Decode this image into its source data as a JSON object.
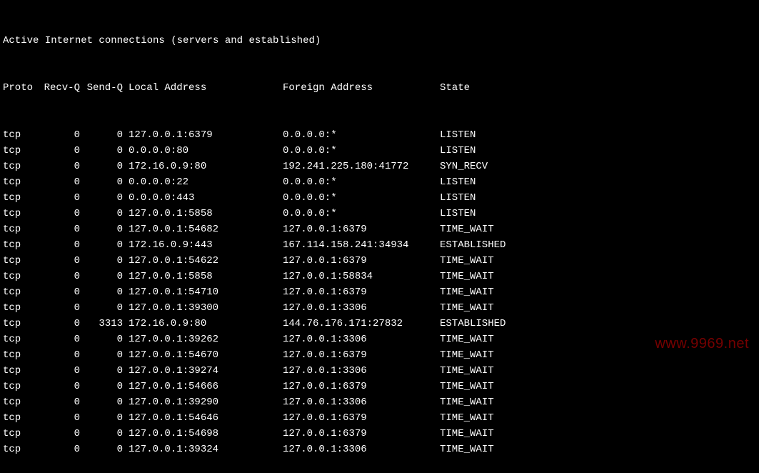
{
  "title": "Active Internet connections (servers and established)",
  "headers": {
    "proto": "Proto",
    "recvq": "Recv-Q",
    "sendq": "Send-Q",
    "local": "Local Address",
    "foreign": "Foreign Address",
    "state": "State"
  },
  "rows": [
    {
      "proto": "tcp",
      "recvq": "0",
      "sendq": "0",
      "local": "127.0.0.1:6379",
      "foreign": "0.0.0.0:*",
      "state": "LISTEN"
    },
    {
      "proto": "tcp",
      "recvq": "0",
      "sendq": "0",
      "local": "0.0.0.0:80",
      "foreign": "0.0.0.0:*",
      "state": "LISTEN"
    },
    {
      "proto": "tcp",
      "recvq": "0",
      "sendq": "0",
      "local": "172.16.0.9:80",
      "foreign": "192.241.225.180:41772",
      "state": "SYN_RECV"
    },
    {
      "proto": "tcp",
      "recvq": "0",
      "sendq": "0",
      "local": "0.0.0.0:22",
      "foreign": "0.0.0.0:*",
      "state": "LISTEN"
    },
    {
      "proto": "tcp",
      "recvq": "0",
      "sendq": "0",
      "local": "0.0.0.0:443",
      "foreign": "0.0.0.0:*",
      "state": "LISTEN"
    },
    {
      "proto": "tcp",
      "recvq": "0",
      "sendq": "0",
      "local": "127.0.0.1:5858",
      "foreign": "0.0.0.0:*",
      "state": "LISTEN"
    },
    {
      "proto": "tcp",
      "recvq": "0",
      "sendq": "0",
      "local": "127.0.0.1:54682",
      "foreign": "127.0.0.1:6379",
      "state": "TIME_WAIT"
    },
    {
      "proto": "tcp",
      "recvq": "0",
      "sendq": "0",
      "local": "172.16.0.9:443",
      "foreign": "167.114.158.241:34934",
      "state": "ESTABLISHED"
    },
    {
      "proto": "tcp",
      "recvq": "0",
      "sendq": "0",
      "local": "127.0.0.1:54622",
      "foreign": "127.0.0.1:6379",
      "state": "TIME_WAIT"
    },
    {
      "proto": "tcp",
      "recvq": "0",
      "sendq": "0",
      "local": "127.0.0.1:5858",
      "foreign": "127.0.0.1:58834",
      "state": "TIME_WAIT"
    },
    {
      "proto": "tcp",
      "recvq": "0",
      "sendq": "0",
      "local": "127.0.0.1:54710",
      "foreign": "127.0.0.1:6379",
      "state": "TIME_WAIT"
    },
    {
      "proto": "tcp",
      "recvq": "0",
      "sendq": "0",
      "local": "127.0.0.1:39300",
      "foreign": "127.0.0.1:3306",
      "state": "TIME_WAIT"
    },
    {
      "proto": "tcp",
      "recvq": "0",
      "sendq": "3313",
      "local": "172.16.0.9:80",
      "foreign": "144.76.176.171:27832",
      "state": "ESTABLISHED"
    },
    {
      "proto": "tcp",
      "recvq": "0",
      "sendq": "0",
      "local": "127.0.0.1:39262",
      "foreign": "127.0.0.1:3306",
      "state": "TIME_WAIT"
    },
    {
      "proto": "tcp",
      "recvq": "0",
      "sendq": "0",
      "local": "127.0.0.1:54670",
      "foreign": "127.0.0.1:6379",
      "state": "TIME_WAIT"
    },
    {
      "proto": "tcp",
      "recvq": "0",
      "sendq": "0",
      "local": "127.0.0.1:39274",
      "foreign": "127.0.0.1:3306",
      "state": "TIME_WAIT"
    },
    {
      "proto": "tcp",
      "recvq": "0",
      "sendq": "0",
      "local": "127.0.0.1:54666",
      "foreign": "127.0.0.1:6379",
      "state": "TIME_WAIT"
    },
    {
      "proto": "tcp",
      "recvq": "0",
      "sendq": "0",
      "local": "127.0.0.1:39290",
      "foreign": "127.0.0.1:3306",
      "state": "TIME_WAIT"
    },
    {
      "proto": "tcp",
      "recvq": "0",
      "sendq": "0",
      "local": "127.0.0.1:54646",
      "foreign": "127.0.0.1:6379",
      "state": "TIME_WAIT"
    },
    {
      "proto": "tcp",
      "recvq": "0",
      "sendq": "0",
      "local": "127.0.0.1:54698",
      "foreign": "127.0.0.1:6379",
      "state": "TIME_WAIT"
    },
    {
      "proto": "tcp",
      "recvq": "0",
      "sendq": "0",
      "local": "127.0.0.1:39324",
      "foreign": "127.0.0.1:3306",
      "state": "TIME_WAIT"
    }
  ],
  "watermark": "www.9969.net"
}
